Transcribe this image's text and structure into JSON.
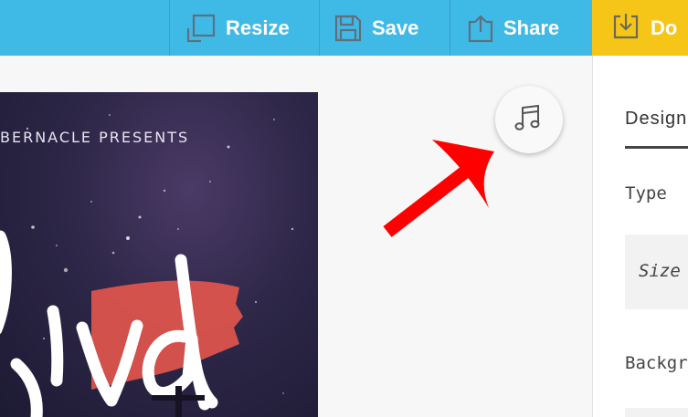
{
  "toolbar": {
    "resize_label": "Resize",
    "save_label": "Save",
    "share_label": "Share",
    "download_label": "Do",
    "background_color": "#3fb9e6",
    "download_color": "#f5c518"
  },
  "poster": {
    "top_text": "BERNACLE PRESENTS",
    "script_text": "ival",
    "first_letter": "l",
    "accent_color": "#e5574d"
  },
  "music_button": {
    "icon": "music-note-icon"
  },
  "annotation": {
    "arrow_color": "#ff0000"
  },
  "panel": {
    "tab_design": "Design",
    "type_label": "Type",
    "size_placeholder": "Size",
    "background_label": "Backgr"
  }
}
